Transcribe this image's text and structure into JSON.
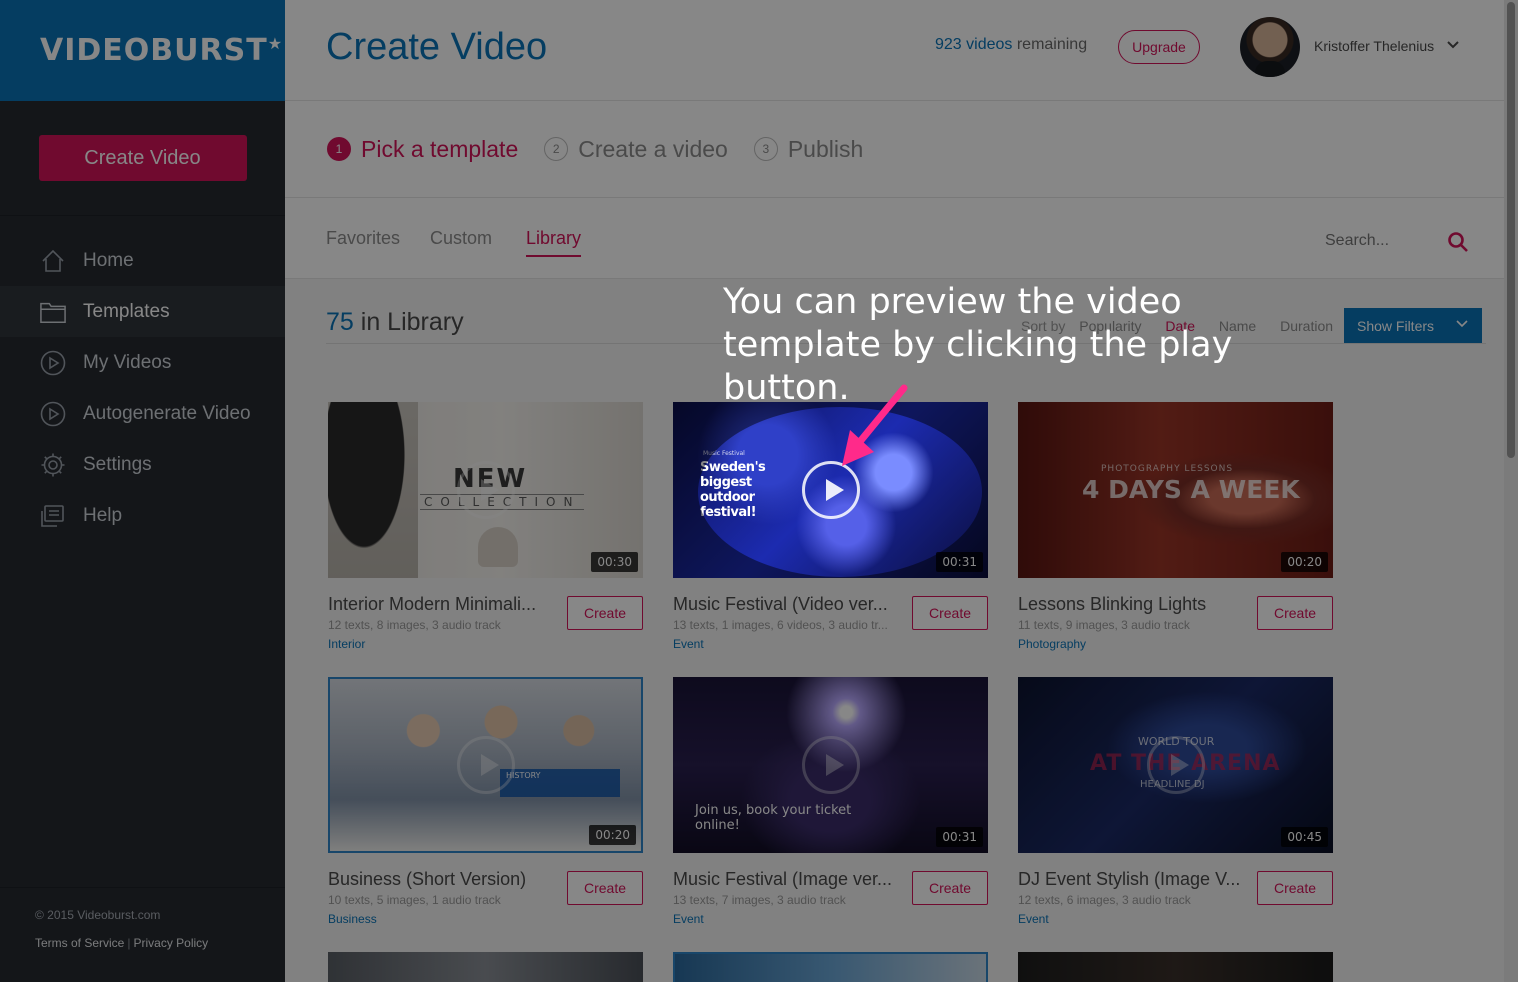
{
  "brand": {
    "logo": "VIDEOBURST",
    "star": "★"
  },
  "sidebar": {
    "cta_label": "Create Video",
    "items": [
      {
        "label": "Home",
        "icon": "home-icon"
      },
      {
        "label": "Templates",
        "icon": "folder-icon"
      },
      {
        "label": "My Videos",
        "icon": "play-circle-icon"
      },
      {
        "label": "Autogenerate Video",
        "icon": "play-circle-icon"
      },
      {
        "label": "Settings",
        "icon": "gear-icon"
      },
      {
        "label": "Help",
        "icon": "help-icon"
      }
    ],
    "active_item": "Templates",
    "copyright": "© 2015 Videoburst.com",
    "terms": "Terms of Service",
    "privacy": "Privacy Policy"
  },
  "header": {
    "title": "Create Video",
    "remaining_count": "923 videos",
    "remaining_suffix": "remaining",
    "upgrade_label": "Upgrade",
    "user_name": "Kristoffer Thelenius"
  },
  "steps": [
    {
      "num": "1",
      "label": "Pick a template"
    },
    {
      "num": "2",
      "label": "Create a video"
    },
    {
      "num": "3",
      "label": "Publish"
    }
  ],
  "tabs": [
    "Favorites",
    "Custom",
    "Library"
  ],
  "active_tab": "Library",
  "search": {
    "placeholder": "Search..."
  },
  "library": {
    "count": "75",
    "label": "in Library",
    "sort_label": "Sort by",
    "sort_options": [
      "Popularity",
      "Date",
      "Name",
      "Duration"
    ],
    "sort_selected": "Date",
    "filters_label": "Show Filters"
  },
  "templates": [
    {
      "title": "Interior Modern Minimali...",
      "meta": "12 texts, 8 images, 3 audio track",
      "category": "Interior",
      "duration": "00:30",
      "create_label": "Create",
      "thumb_text": "NEW",
      "thumb_sub": "COLLECTION"
    },
    {
      "title": "Music Festival (Video ver...",
      "meta": "13 texts, 1 images, 6 videos, 3 audio tr...",
      "category": "Event",
      "duration": "00:31",
      "create_label": "Create",
      "thumb_text": "Sweden's biggest outdoor festival!",
      "thumb_sub": "Music Festival"
    },
    {
      "title": "Lessons Blinking Lights",
      "meta": "11 texts, 9 images, 3 audio track",
      "category": "Photography",
      "duration": "00:20",
      "create_label": "Create",
      "thumb_text": "4 DAYS A WEEK",
      "thumb_sub": "PHOTOGRAPHY LESSONS"
    },
    {
      "title": "Business (Short Version)",
      "meta": "10 texts, 5 images, 1 audio track",
      "category": "Business",
      "duration": "00:20",
      "create_label": "Create",
      "thumb_text": "HISTORY",
      "thumb_sub": ""
    },
    {
      "title": "Music Festival (Image ver...",
      "meta": "13 texts, 7 images, 3 audio track",
      "category": "Event",
      "duration": "00:31",
      "create_label": "Create",
      "thumb_text": "Join us, book your ticket online!",
      "thumb_sub": ""
    },
    {
      "title": "DJ Event Stylish (Image V...",
      "meta": "12 texts, 6 images, 3 audio track",
      "category": "Event",
      "duration": "00:45",
      "create_label": "Create",
      "thumb_text": "AT THE ARENA",
      "thumb_sub": "WORLD TOUR",
      "thumb_sub2": "HEADLINE DJ"
    }
  ],
  "tooltip": {
    "text": "You can preview the video template by clicking the play button."
  },
  "colors": {
    "brand_blue": "#0a74b8",
    "accent_pink": "#d4145a",
    "sidebar_bg": "#262a30"
  }
}
